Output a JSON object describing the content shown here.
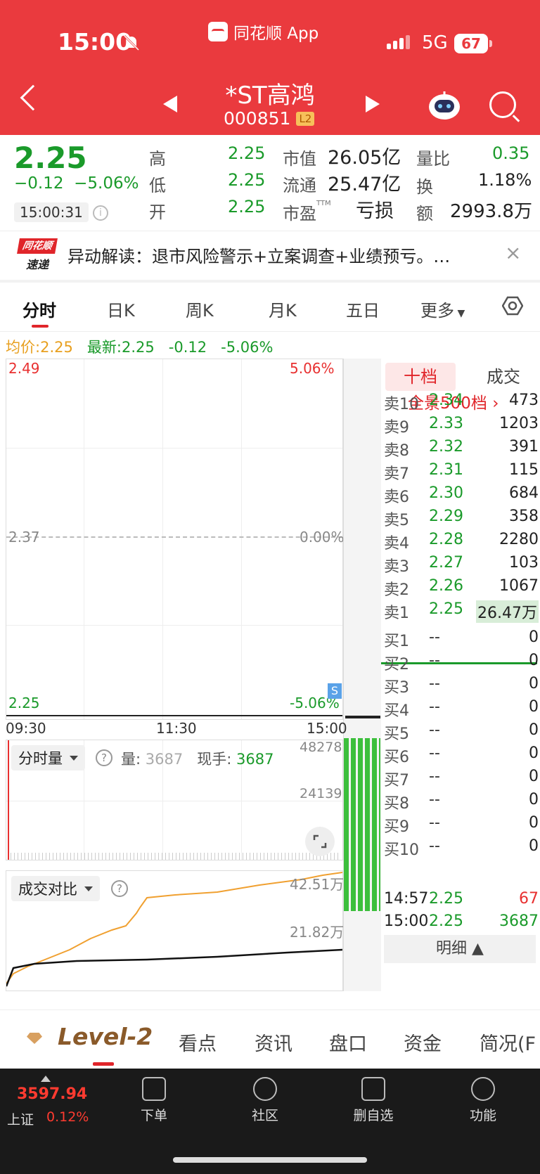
{
  "status_bar": {
    "time": "15:00",
    "app_label": "同花顺 App",
    "network": "5G",
    "battery": "67"
  },
  "header": {
    "name": "*ST高鸿",
    "code": "000851",
    "level_badge": "L2"
  },
  "quote": {
    "price": "2.25",
    "change": "−0.12",
    "change_pct": "−5.06%",
    "timestamp": "15:00:31",
    "fields": [
      {
        "label": "高",
        "value": "2.25"
      },
      {
        "label": "低",
        "value": "2.25"
      },
      {
        "label": "开",
        "value": "2.25"
      },
      {
        "label": "市值",
        "value": "26.05亿"
      },
      {
        "label": "流通",
        "value": "25.47亿"
      },
      {
        "label": "市盈",
        "suffix": "TTM",
        "value": "亏损"
      },
      {
        "label": "量比",
        "value": "0.35"
      },
      {
        "label": "换",
        "value": "1.18%"
      },
      {
        "label": "额",
        "value": "2993.8万"
      }
    ]
  },
  "news": {
    "source": "同花顺",
    "source_sub": "速递",
    "text": "异动解读：退市风险警示+立案调查+业绩预亏。…",
    "close": "×"
  },
  "tabs": [
    "分时",
    "日K",
    "周K",
    "月K",
    "五日",
    "更多"
  ],
  "minute_chart": {
    "avg_label": "均价:",
    "avg_value": "2.25",
    "latest_label": "最新:",
    "latest_value": "2.25",
    "latest_change": "-0.12",
    "latest_pct": "-5.06%",
    "y_top": "2.49",
    "y_mid": "2.37",
    "y_bot": "2.25",
    "pct_top": "5.06%",
    "pct_mid": "0.00%",
    "pct_bot": "-5.06%",
    "s_mark": "S",
    "time_start": "09:30",
    "time_mid": "11:30",
    "time_end": "15:00"
  },
  "volume_panel": {
    "selector": "分时量",
    "vol_label": "量:",
    "vol_value": "3687",
    "hand_label": "现手:",
    "hand_value": "3687",
    "y_top": "48278",
    "y_mid": "24139"
  },
  "compare_panel": {
    "selector": "成交对比",
    "y_top": "42.51万",
    "y_mid": "21.82万"
  },
  "order_book": {
    "tab_active": "十档",
    "tab_other": "成交",
    "full_depth": "全景500档 ›",
    "asks": [
      {
        "label": "卖10",
        "price": "2.34",
        "vol": "473"
      },
      {
        "label": "卖9",
        "price": "2.33",
        "vol": "1203"
      },
      {
        "label": "卖8",
        "price": "2.32",
        "vol": "391"
      },
      {
        "label": "卖7",
        "price": "2.31",
        "vol": "115"
      },
      {
        "label": "卖6",
        "price": "2.30",
        "vol": "684"
      },
      {
        "label": "卖5",
        "price": "2.29",
        "vol": "358"
      },
      {
        "label": "卖4",
        "price": "2.28",
        "vol": "2280"
      },
      {
        "label": "卖3",
        "price": "2.27",
        "vol": "103"
      },
      {
        "label": "卖2",
        "price": "2.26",
        "vol": "1067"
      },
      {
        "label": "卖1",
        "price": "2.25",
        "vol": "26.47万"
      }
    ],
    "bids": [
      {
        "label": "买1",
        "price": "--",
        "vol": "0"
      },
      {
        "label": "买2",
        "price": "--",
        "vol": "0"
      },
      {
        "label": "买3",
        "price": "--",
        "vol": "0"
      },
      {
        "label": "买4",
        "price": "--",
        "vol": "0"
      },
      {
        "label": "买5",
        "price": "--",
        "vol": "0"
      },
      {
        "label": "买6",
        "price": "--",
        "vol": "0"
      },
      {
        "label": "买7",
        "price": "--",
        "vol": "0"
      },
      {
        "label": "买8",
        "price": "--",
        "vol": "0"
      },
      {
        "label": "买9",
        "price": "--",
        "vol": "0"
      },
      {
        "label": "买10",
        "price": "--",
        "vol": "0"
      }
    ],
    "detail_label": "明细 ▲",
    "trades": [
      {
        "time": "14:57",
        "price": "2.25",
        "vol": "67"
      },
      {
        "time": "15:00",
        "price": "2.25",
        "vol": "3687"
      }
    ]
  },
  "bottom_tabs": {
    "level2": "Level-2",
    "items": [
      "看点",
      "资讯",
      "盘口",
      "资金",
      "简况(F"
    ]
  },
  "footer": {
    "index_value": "3597.94",
    "index_name": "上证",
    "index_pct": "0.12%",
    "buttons": [
      "下单",
      "社区",
      "删自选",
      "功能"
    ]
  }
}
